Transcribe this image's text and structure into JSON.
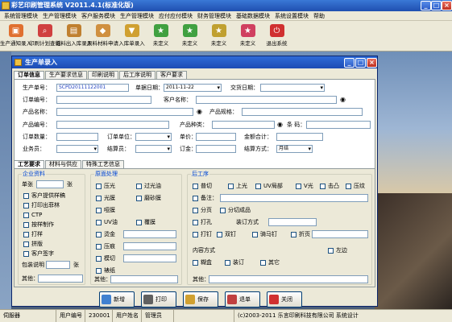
{
  "app": {
    "title": "彩艺印刷管理系统 V2011.4.1(标准化版)"
  },
  "menu": [
    "系统管理模块",
    "生产管理模块",
    "客户服务模块",
    "生产管理模块",
    "应付应付模块",
    "财务管理模块",
    "基础数据模块",
    "系统设置模块",
    "帮助"
  ],
  "toolbar": [
    {
      "label": "生产通知录入",
      "icon": "order-icon",
      "color": "#e07030"
    },
    {
      "label": "印刷计划查询",
      "icon": "search-icon",
      "color": "#d04040"
    },
    {
      "label": "纸料出入库录入",
      "icon": "paper-icon",
      "color": "#c08030"
    },
    {
      "label": "原料材料申请",
      "icon": "material-icon",
      "color": "#d09040"
    },
    {
      "label": "入库单录入",
      "icon": "inbox-icon",
      "color": "#d0a030"
    },
    {
      "label": "未定义",
      "icon": "star-icon",
      "color": "#40a040"
    },
    {
      "label": "未定义",
      "icon": "star-icon",
      "color": "#40a040"
    },
    {
      "label": "未定义",
      "icon": "star-icon",
      "color": "#c0a030"
    },
    {
      "label": "未定义",
      "icon": "star-icon",
      "color": "#d04060"
    },
    {
      "label": "退出系统",
      "icon": "exit-icon",
      "color": "#d03030"
    }
  ],
  "window": {
    "title": "生产单录入"
  },
  "tabs": [
    "订单信息",
    "生产要求信息",
    "印刷说明",
    "后工序说明",
    "客户要求"
  ],
  "form": {
    "order_no_label": "生产单号：",
    "order_no_value": "SCPD20111122001",
    "order_date_label": "单据日期：",
    "order_date_value": "2011-11-22",
    "deliver_label": "交货日期：",
    "contract_label": "订单编号：",
    "customer_label": "客户名称：",
    "product_label": "产品名称：",
    "spec_label": "产品规格：",
    "product_no_label": "产品编号：",
    "category_label": "产品种类：",
    "barcode_label": "条 码：",
    "qty_label": "订单数量：",
    "unit_label": "订单单位：",
    "price_label": "单价：",
    "amount_label": "金额合计：",
    "salesman_label": "业务员：",
    "make_by_label": "结算员：",
    "deposit_label": "订金：",
    "settle_label": "结算方式：",
    "settle_value": "月结"
  },
  "sub_tabs": [
    "工艺要求",
    "材料与供应",
    "特殊工艺信息"
  ],
  "groups": {
    "left": "企业资料",
    "mid": "原面处理",
    "right": "后工序"
  },
  "left_items": [
    "单张",
    "客户提供样稿",
    "打印出菲林",
    "CTP",
    "按样制作",
    "打样",
    "拼版",
    "客户签字"
  ],
  "left_footer": {
    "pieces_label": "张",
    "pack_label": "包装说明",
    "pack_unit": "张",
    "other_label": "其他："
  },
  "mid_items": [
    "压光",
    "光膜",
    "哑膜",
    "UV油",
    "烫金",
    "压痕",
    "模切",
    "裱纸"
  ],
  "mid_right": [
    "过光油",
    "磨砂膜",
    "覆膜"
  ],
  "mid_other": "其他：",
  "right_items": [
    "普切",
    "上光",
    "UV局部",
    "V光",
    "击凸",
    "压纹"
  ],
  "right_labels": [
    "备注：",
    "分页",
    "分切成品",
    "打孔",
    "装订方式",
    "打钉",
    "双钉",
    "骑马钉",
    "折页",
    "糊盒",
    "装订",
    "其它",
    "左边",
    "内容方式"
  ],
  "right_other": "其他：",
  "buttons": [
    "新增",
    "打印",
    "保存",
    "退单",
    "关闭"
  ],
  "status": [
    "伺服器",
    "用户编号",
    "230001",
    "用户姓名",
    "管理员",
    "",
    "(c)2003-2011 乐言印刷科技有限公司 系统设计"
  ]
}
